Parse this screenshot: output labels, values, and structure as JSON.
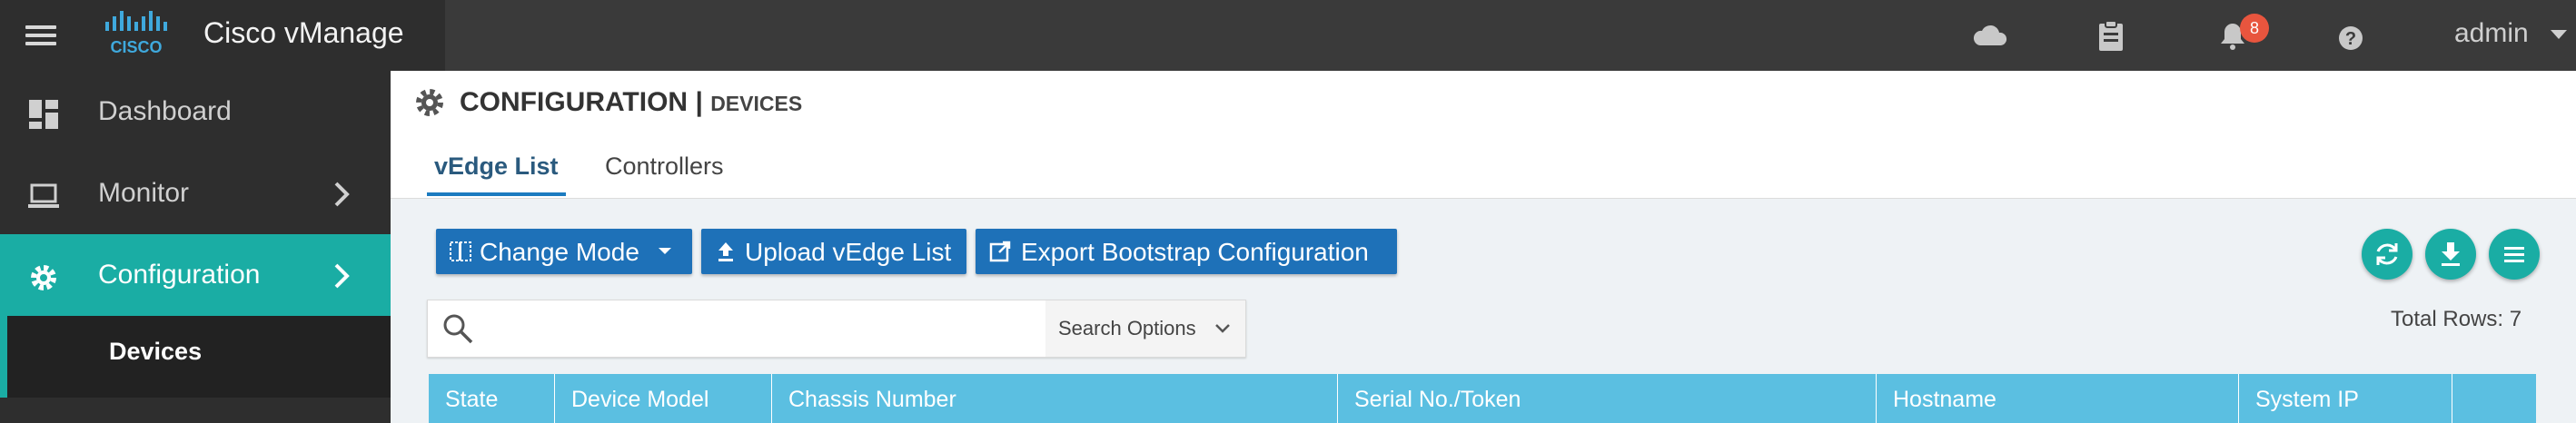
{
  "app": {
    "title": "Cisco vManage",
    "brand_logo_text": "CISCO"
  },
  "topbar": {
    "icons": [
      "cloud-icon",
      "clipboard-icon",
      "bell-icon",
      "help-icon"
    ],
    "notification_count": "8",
    "user": "admin"
  },
  "sidebar": {
    "items": [
      {
        "label": "Dashboard",
        "icon": "dashboard-icon",
        "has_submenu": false,
        "active": false
      },
      {
        "label": "Monitor",
        "icon": "laptop-icon",
        "has_submenu": true,
        "active": false
      },
      {
        "label": "Configuration",
        "icon": "gear-icon",
        "has_submenu": true,
        "active": true
      }
    ],
    "sub_item": "Devices"
  },
  "header": {
    "title": "CONFIGURATION",
    "separator": "|",
    "subtitle": "DEVICES",
    "tabs": [
      {
        "label": "vEdge List",
        "active": true
      },
      {
        "label": "Controllers",
        "active": false
      }
    ]
  },
  "toolbar": {
    "change_mode": "Change Mode",
    "upload": "Upload vEdge List",
    "export": "Export Bootstrap Configuration"
  },
  "search": {
    "placeholder": "",
    "options_label": "Search Options"
  },
  "total_rows": "Total Rows: 7",
  "table": {
    "columns": [
      "State",
      "Device Model",
      "Chassis Number",
      "Serial No./Token",
      "Hostname",
      "System IP"
    ]
  },
  "colors": {
    "accent_teal": "#1aada4",
    "button_blue": "#1e71b8",
    "table_header": "#5bbfe1",
    "topbar": "#3a3a3a",
    "badge": "#e8553e"
  }
}
